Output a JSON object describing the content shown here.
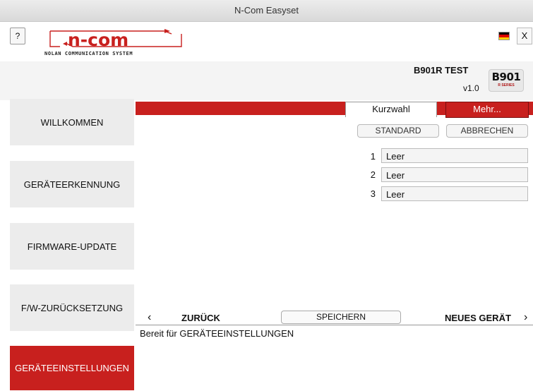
{
  "window": {
    "title": "N-Com Easyset"
  },
  "header": {
    "help_label": "?",
    "close_label": "X",
    "logo_text": "n-com",
    "logo_tagline": "NOLAN COMMUNICATION SYSTEM",
    "flag_icon": "german-flag-icon",
    "flag_colors": [
      "#000000",
      "#dd0000",
      "#ffce00"
    ]
  },
  "device": {
    "name": "B901R TEST",
    "version": "v1.0",
    "badge_main": "B901",
    "badge_sub": "R SERIES"
  },
  "sidebar": {
    "items": [
      {
        "label": "WILLKOMMEN",
        "active": false
      },
      {
        "label": "GERÄTEERKENNUNG",
        "active": false
      },
      {
        "label": "FIRMWARE-UPDATE",
        "active": false
      },
      {
        "label": "F/W-ZURÜCKSETZUNG",
        "active": false
      },
      {
        "label": "GERÄTEEINSTELLUNGEN",
        "active": true
      }
    ]
  },
  "tabs": [
    {
      "label": "Kurzwahl",
      "active": true
    },
    {
      "label": "Mehr...",
      "active": false
    }
  ],
  "speed_dial": {
    "standard_label": "STANDARD",
    "cancel_label": "ABBRECHEN",
    "entries": [
      {
        "num": "1",
        "value": "Leer"
      },
      {
        "num": "2",
        "value": "Leer"
      },
      {
        "num": "3",
        "value": "Leer"
      }
    ]
  },
  "footer_nav": {
    "back_label": "ZURÜCK",
    "save_label": "SPEICHERN",
    "next_label": "NEUES GERÄT"
  },
  "status": {
    "text": "Bereit für GERÄTEEINSTELLUNGEN"
  },
  "colors": {
    "accent": "#c8201e",
    "panel": "#ececec"
  }
}
